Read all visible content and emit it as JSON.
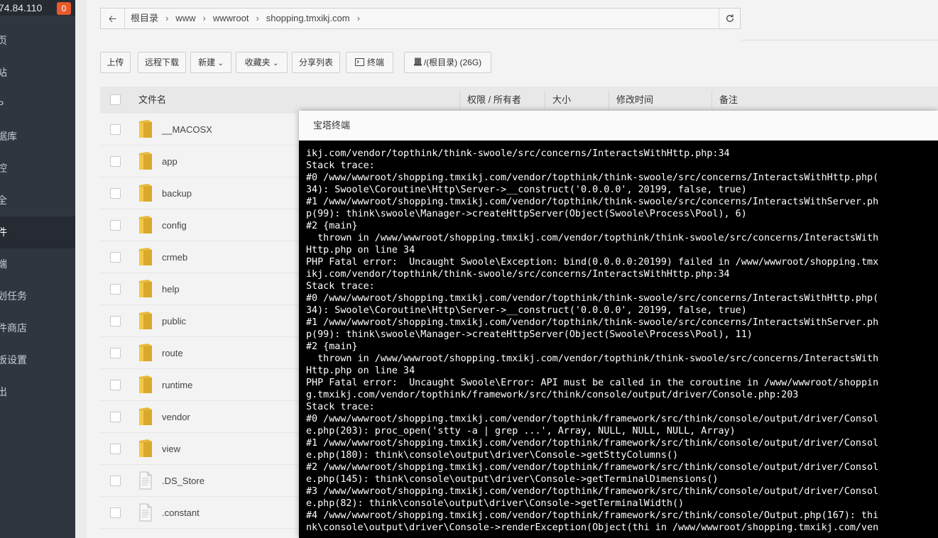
{
  "sidebar": {
    "ip": "74.84.110",
    "badge": "0",
    "items": [
      {
        "label": "页"
      },
      {
        "label": "站"
      },
      {
        "label": "P"
      },
      {
        "label": "据库"
      },
      {
        "label": "控"
      },
      {
        "label": "全"
      },
      {
        "label": "件",
        "active": true
      },
      {
        "label": "端"
      },
      {
        "label": "划任务"
      },
      {
        "label": "件商店"
      },
      {
        "label": "板设置"
      },
      {
        "label": "出"
      }
    ]
  },
  "pathbar": {
    "back_icon": "arrow-left-icon",
    "crumbs": [
      "根目录",
      "www",
      "wwwroot",
      "shopping.tmxikj.com"
    ],
    "refresh_icon": "refresh-icon"
  },
  "toolbar": {
    "upload": "上传",
    "remote_download": "远程下载",
    "new": "新建",
    "favorites": "收藏夹",
    "share_list": "分享列表",
    "terminal": "终端",
    "disk": "/(根目录) (26G)"
  },
  "table": {
    "headers": {
      "filename": "文件名",
      "permission": "权限 / 所有者",
      "size": "大小",
      "mtime": "修改时间",
      "note": "备注"
    },
    "rows": [
      {
        "name": "__MACOSX",
        "type": "folder"
      },
      {
        "name": "app",
        "type": "folder"
      },
      {
        "name": "backup",
        "type": "folder"
      },
      {
        "name": "config",
        "type": "folder"
      },
      {
        "name": "crmeb",
        "type": "folder"
      },
      {
        "name": "help",
        "type": "folder"
      },
      {
        "name": "public",
        "type": "folder"
      },
      {
        "name": "route",
        "type": "folder"
      },
      {
        "name": "runtime",
        "type": "folder"
      },
      {
        "name": "vendor",
        "type": "folder"
      },
      {
        "name": "view",
        "type": "folder"
      },
      {
        "name": ".DS_Store",
        "type": "file"
      },
      {
        "name": ".constant",
        "type": "file"
      }
    ]
  },
  "modal": {
    "title": "宝塔终端",
    "terminal_lines": [
      "ikj.com/vendor/topthink/think-swoole/src/concerns/InteractsWithHttp.php:34",
      "Stack trace:",
      "#0 /www/wwwroot/shopping.tmxikj.com/vendor/topthink/think-swoole/src/concerns/InteractsWithHttp.php(",
      "34): Swoole\\Coroutine\\Http\\Server->__construct('0.0.0.0', 20199, false, true)",
      "#1 /www/wwwroot/shopping.tmxikj.com/vendor/topthink/think-swoole/src/concerns/InteractsWithServer.ph",
      "p(99): think\\swoole\\Manager->createHttpServer(Object(Swoole\\Process\\Pool), 6)",
      "#2 {main}",
      "  thrown in /www/wwwroot/shopping.tmxikj.com/vendor/topthink/think-swoole/src/concerns/InteractsWith",
      "Http.php on line 34",
      "PHP Fatal error:  Uncaught Swoole\\Exception: bind(0.0.0.0:20199) failed in /www/wwwroot/shopping.tmx",
      "ikj.com/vendor/topthink/think-swoole/src/concerns/InteractsWithHttp.php:34",
      "Stack trace:",
      "#0 /www/wwwroot/shopping.tmxikj.com/vendor/topthink/think-swoole/src/concerns/InteractsWithHttp.php(",
      "34): Swoole\\Coroutine\\Http\\Server->__construct('0.0.0.0', 20199, false, true)",
      "#1 /www/wwwroot/shopping.tmxikj.com/vendor/topthink/think-swoole/src/concerns/InteractsWithServer.ph",
      "p(99): think\\swoole\\Manager->createHttpServer(Object(Swoole\\Process\\Pool), 11)",
      "#2 {main}",
      "  thrown in /www/wwwroot/shopping.tmxikj.com/vendor/topthink/think-swoole/src/concerns/InteractsWith",
      "Http.php on line 34",
      "PHP Fatal error:  Uncaught Swoole\\Error: API must be called in the coroutine in /www/wwwroot/shoppin",
      "g.tmxikj.com/vendor/topthink/framework/src/think/console/output/driver/Console.php:203",
      "Stack trace:",
      "#0 /www/wwwroot/shopping.tmxikj.com/vendor/topthink/framework/src/think/console/output/driver/Consol",
      "e.php(203): proc_open('stty -a | grep ...', Array, NULL, NULL, NULL, Array)",
      "#1 /www/wwwroot/shopping.tmxikj.com/vendor/topthink/framework/src/think/console/output/driver/Consol",
      "e.php(180): think\\console\\output\\driver\\Console->getSttyColumns()",
      "#2 /www/wwwroot/shopping.tmxikj.com/vendor/topthink/framework/src/think/console/output/driver/Consol",
      "e.php(145): think\\console\\output\\driver\\Console->getTerminalDimensions()",
      "#3 /www/wwwroot/shopping.tmxikj.com/vendor/topthink/framework/src/think/console/output/driver/Consol",
      "e.php(82): think\\console\\output\\driver\\Console->getTerminalWidth()",
      "#4 /www/wwwroot/shopping.tmxikj.com/vendor/topthink/framework/src/think/console/Output.php(167): thi",
      "nk\\console\\output\\driver\\Console->renderException(Object(thi in /www/wwwroot/shopping.tmxikj.com/ven"
    ]
  }
}
